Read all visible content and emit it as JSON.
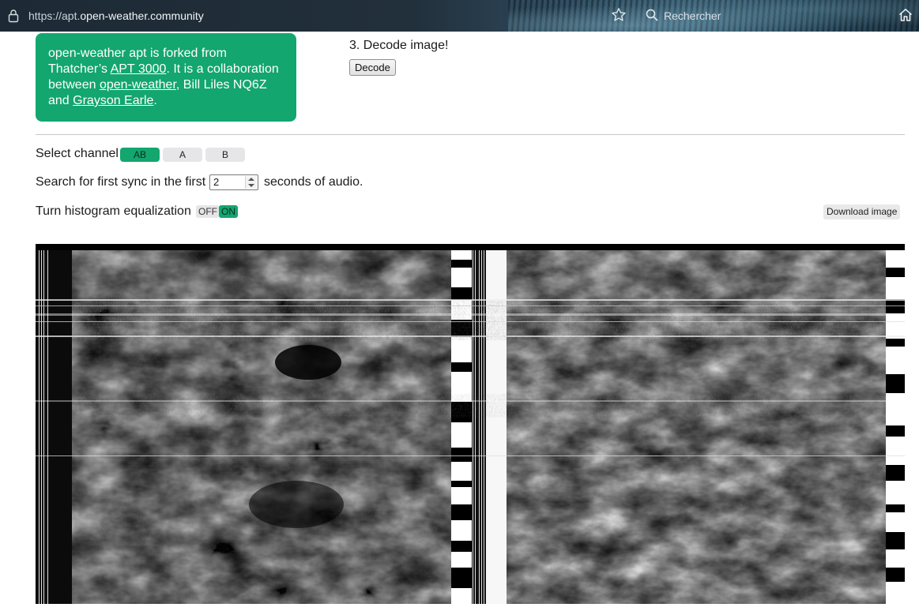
{
  "browser": {
    "url_scheme": "https://apt.",
    "url_host": "open-weather.community",
    "search_placeholder": "Rechercher"
  },
  "info_box": {
    "text_1": "open-weather apt is forked from Thatcher’s ",
    "link_apt": "APT 3000",
    "text_2": ". It is a collaboration between ",
    "link_ow": "open-weather",
    "text_3": ", Bill Liles NQ6Z and ",
    "link_ge": "Grayson Earle",
    "text_4": "."
  },
  "decode": {
    "step_title": "3. Decode image!",
    "button_label": "Decode"
  },
  "options": {
    "channel_label": "Select channel",
    "channels": [
      "AB",
      "A",
      "B"
    ],
    "selected_channel": "AB",
    "sync_label_before": "Search for first sync in the first",
    "sync_value": "2",
    "sync_label_after": "seconds of audio.",
    "histogram_label": "Turn histogram equalization",
    "toggle_off": "OFF",
    "toggle_on": "ON",
    "histogram_state": "ON",
    "download_label": "Download image"
  },
  "colors": {
    "accent": "#13a66e"
  },
  "icons": [
    "lock-icon",
    "bookmark-star-icon",
    "search-icon",
    "home-icon"
  ]
}
